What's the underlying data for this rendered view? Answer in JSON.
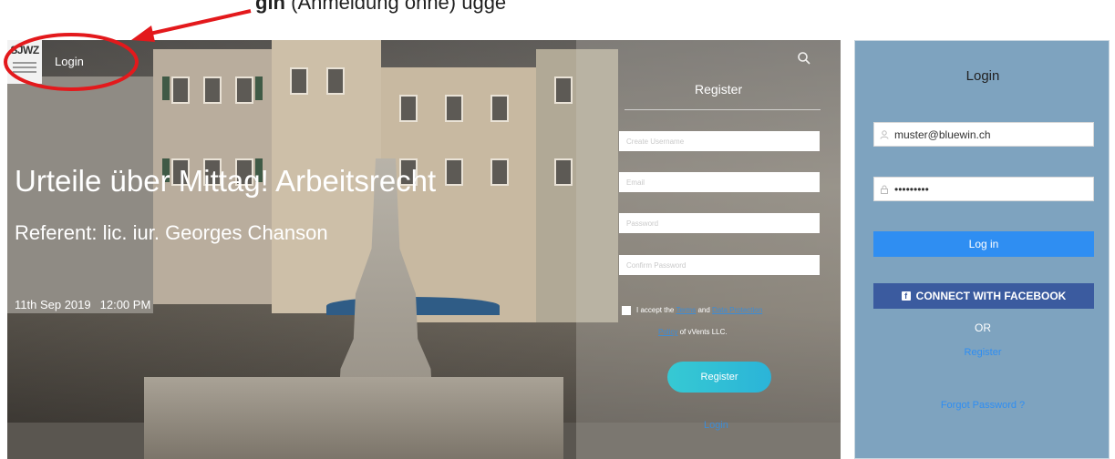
{
  "annotation": {
    "caption_prefix": "gin",
    "caption_rest": " (Anmeldung ohne)                          ügge",
    "arrow_color": "#e3191c"
  },
  "site": {
    "logo_text": "SJWZ",
    "nav_login": "Login",
    "search_icon": "search-icon"
  },
  "event": {
    "title": "Urteile über Mittag! Arbeitsrecht",
    "speaker": "Referent: lic. iur. Georges Chanson",
    "date": "11th Sep 2019",
    "time": "12:00 PM"
  },
  "register": {
    "title": "Register",
    "username_placeholder": "Create Username",
    "email_placeholder": "Email",
    "password_placeholder": "Password",
    "confirm_placeholder": "Confirm Password",
    "terms_prefix": "I accept the",
    "terms_link": "Terms",
    "terms_and": "and",
    "data_link": "Data Protection",
    "policy_link": "Policy",
    "terms_suffix": "of vVents LLC.",
    "button_label": "Register",
    "login_link": "Login",
    "accent_color": "#36c9d3"
  },
  "login": {
    "title": "Login",
    "email_value": "muster@bluewin.ch",
    "password_value": "•••••••••",
    "login_button": "Log in",
    "facebook_button": "CONNECT WITH FACEBOOK",
    "or_text": "OR",
    "register_link": "Register",
    "forgot_link": "Forgot Password ?",
    "panel_color": "#7ea3bf",
    "login_color": "#2f8ef2",
    "facebook_color": "#3b5b9f"
  }
}
